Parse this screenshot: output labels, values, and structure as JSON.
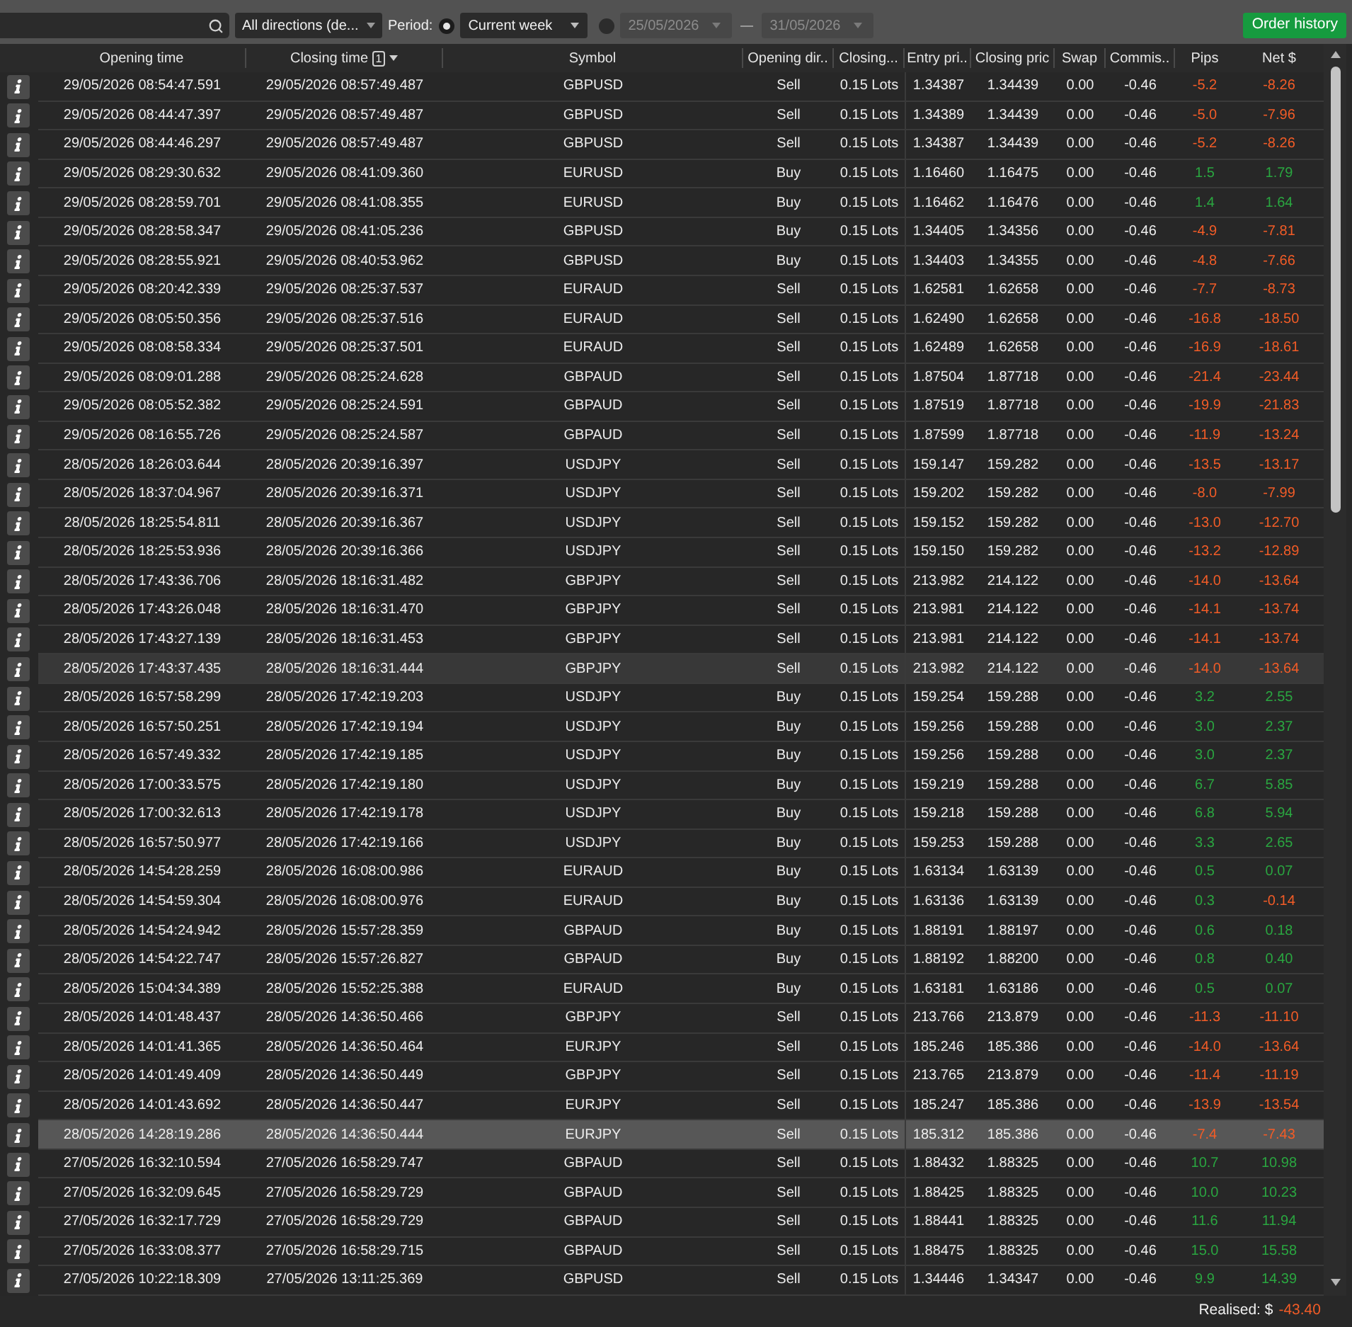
{
  "toolbar": {
    "direction_filter": {
      "value": "All directions (de..."
    },
    "period": {
      "label": "Period:",
      "options": [
        {
          "kind": "preset",
          "selected": true,
          "value": "Current week"
        },
        {
          "kind": "range",
          "selected": false,
          "from": "25/05/2026",
          "to": "31/05/2026"
        }
      ]
    },
    "order_history_button": "Order history"
  },
  "table": {
    "columns": [
      {
        "label": "Opening time"
      },
      {
        "label": "Closing time",
        "sort_rank": "1",
        "sorted_descending": true
      },
      {
        "label": "Symbol"
      },
      {
        "label": "Opening dir.."
      },
      {
        "label": "Closing..."
      },
      {
        "label": "Entry pri.."
      },
      {
        "label": "Closing pric"
      },
      {
        "label": "Swap"
      },
      {
        "label": "Commis.."
      },
      {
        "label": "Pips"
      },
      {
        "label": "Net $"
      }
    ],
    "rows": [
      {
        "opening_time": "29/05/2026 08:54:47.591",
        "closing_time": "29/05/2026 08:57:49.487",
        "symbol": "GBPUSD",
        "direction": "Sell",
        "volume": "0.15 Lots",
        "entry_price": "1.34387",
        "closing_price": "1.34439",
        "swap": "0.00",
        "commission": "-0.46",
        "pips": {
          "text": "-5.2",
          "color": "#f25c27"
        },
        "net": {
          "text": "-8.26",
          "color": "#f25c27"
        },
        "selected": false,
        "hovered": false
      },
      {
        "opening_time": "29/05/2026 08:44:47.397",
        "closing_time": "29/05/2026 08:57:49.487",
        "symbol": "GBPUSD",
        "direction": "Sell",
        "volume": "0.15 Lots",
        "entry_price": "1.34389",
        "closing_price": "1.34439",
        "swap": "0.00",
        "commission": "-0.46",
        "pips": {
          "text": "-5.0",
          "color": "#f25c27"
        },
        "net": {
          "text": "-7.96",
          "color": "#f25c27"
        },
        "selected": false,
        "hovered": false
      },
      {
        "opening_time": "29/05/2026 08:44:46.297",
        "closing_time": "29/05/2026 08:57:49.487",
        "symbol": "GBPUSD",
        "direction": "Sell",
        "volume": "0.15 Lots",
        "entry_price": "1.34387",
        "closing_price": "1.34439",
        "swap": "0.00",
        "commission": "-0.46",
        "pips": {
          "text": "-5.2",
          "color": "#f25c27"
        },
        "net": {
          "text": "-8.26",
          "color": "#f25c27"
        },
        "selected": false,
        "hovered": false
      },
      {
        "opening_time": "29/05/2026 08:29:30.632",
        "closing_time": "29/05/2026 08:41:09.360",
        "symbol": "EURUSD",
        "direction": "Buy",
        "volume": "0.15 Lots",
        "entry_price": "1.16460",
        "closing_price": "1.16475",
        "swap": "0.00",
        "commission": "-0.46",
        "pips": {
          "text": "1.5",
          "color": "#2aa640"
        },
        "net": {
          "text": "1.79",
          "color": "#2aa640"
        },
        "selected": false,
        "hovered": false
      },
      {
        "opening_time": "29/05/2026 08:28:59.701",
        "closing_time": "29/05/2026 08:41:08.355",
        "symbol": "EURUSD",
        "direction": "Buy",
        "volume": "0.15 Lots",
        "entry_price": "1.16462",
        "closing_price": "1.16476",
        "swap": "0.00",
        "commission": "-0.46",
        "pips": {
          "text": "1.4",
          "color": "#2aa640"
        },
        "net": {
          "text": "1.64",
          "color": "#2aa640"
        },
        "selected": false,
        "hovered": false
      },
      {
        "opening_time": "29/05/2026 08:28:58.347",
        "closing_time": "29/05/2026 08:41:05.236",
        "symbol": "GBPUSD",
        "direction": "Buy",
        "volume": "0.15 Lots",
        "entry_price": "1.34405",
        "closing_price": "1.34356",
        "swap": "0.00",
        "commission": "-0.46",
        "pips": {
          "text": "-4.9",
          "color": "#f25c27"
        },
        "net": {
          "text": "-7.81",
          "color": "#f25c27"
        },
        "selected": false,
        "hovered": false
      },
      {
        "opening_time": "29/05/2026 08:28:55.921",
        "closing_time": "29/05/2026 08:40:53.962",
        "symbol": "GBPUSD",
        "direction": "Buy",
        "volume": "0.15 Lots",
        "entry_price": "1.34403",
        "closing_price": "1.34355",
        "swap": "0.00",
        "commission": "-0.46",
        "pips": {
          "text": "-4.8",
          "color": "#f25c27"
        },
        "net": {
          "text": "-7.66",
          "color": "#f25c27"
        },
        "selected": false,
        "hovered": false
      },
      {
        "opening_time": "29/05/2026 08:20:42.339",
        "closing_time": "29/05/2026 08:25:37.537",
        "symbol": "EURAUD",
        "direction": "Sell",
        "volume": "0.15 Lots",
        "entry_price": "1.62581",
        "closing_price": "1.62658",
        "swap": "0.00",
        "commission": "-0.46",
        "pips": {
          "text": "-7.7",
          "color": "#f25c27"
        },
        "net": {
          "text": "-8.73",
          "color": "#f25c27"
        },
        "selected": false,
        "hovered": false
      },
      {
        "opening_time": "29/05/2026 08:05:50.356",
        "closing_time": "29/05/2026 08:25:37.516",
        "symbol": "EURAUD",
        "direction": "Sell",
        "volume": "0.15 Lots",
        "entry_price": "1.62490",
        "closing_price": "1.62658",
        "swap": "0.00",
        "commission": "-0.46",
        "pips": {
          "text": "-16.8",
          "color": "#f25c27"
        },
        "net": {
          "text": "-18.50",
          "color": "#f25c27"
        },
        "selected": false,
        "hovered": false
      },
      {
        "opening_time": "29/05/2026 08:08:58.334",
        "closing_time": "29/05/2026 08:25:37.501",
        "symbol": "EURAUD",
        "direction": "Sell",
        "volume": "0.15 Lots",
        "entry_price": "1.62489",
        "closing_price": "1.62658",
        "swap": "0.00",
        "commission": "-0.46",
        "pips": {
          "text": "-16.9",
          "color": "#f25c27"
        },
        "net": {
          "text": "-18.61",
          "color": "#f25c27"
        },
        "selected": false,
        "hovered": false
      },
      {
        "opening_time": "29/05/2026 08:09:01.288",
        "closing_time": "29/05/2026 08:25:24.628",
        "symbol": "GBPAUD",
        "direction": "Sell",
        "volume": "0.15 Lots",
        "entry_price": "1.87504",
        "closing_price": "1.87718",
        "swap": "0.00",
        "commission": "-0.46",
        "pips": {
          "text": "-21.4",
          "color": "#f25c27"
        },
        "net": {
          "text": "-23.44",
          "color": "#f25c27"
        },
        "selected": false,
        "hovered": false
      },
      {
        "opening_time": "29/05/2026 08:05:52.382",
        "closing_time": "29/05/2026 08:25:24.591",
        "symbol": "GBPAUD",
        "direction": "Sell",
        "volume": "0.15 Lots",
        "entry_price": "1.87519",
        "closing_price": "1.87718",
        "swap": "0.00",
        "commission": "-0.46",
        "pips": {
          "text": "-19.9",
          "color": "#f25c27"
        },
        "net": {
          "text": "-21.83",
          "color": "#f25c27"
        },
        "selected": false,
        "hovered": false
      },
      {
        "opening_time": "29/05/2026 08:16:55.726",
        "closing_time": "29/05/2026 08:25:24.587",
        "symbol": "GBPAUD",
        "direction": "Sell",
        "volume": "0.15 Lots",
        "entry_price": "1.87599",
        "closing_price": "1.87718",
        "swap": "0.00",
        "commission": "-0.46",
        "pips": {
          "text": "-11.9",
          "color": "#f25c27"
        },
        "net": {
          "text": "-13.24",
          "color": "#f25c27"
        },
        "selected": false,
        "hovered": false
      },
      {
        "opening_time": "28/05/2026 18:26:03.644",
        "closing_time": "28/05/2026 20:39:16.397",
        "symbol": "USDJPY",
        "direction": "Sell",
        "volume": "0.15 Lots",
        "entry_price": "159.147",
        "closing_price": "159.282",
        "swap": "0.00",
        "commission": "-0.46",
        "pips": {
          "text": "-13.5",
          "color": "#f25c27"
        },
        "net": {
          "text": "-13.17",
          "color": "#f25c27"
        },
        "selected": false,
        "hovered": false
      },
      {
        "opening_time": "28/05/2026 18:37:04.967",
        "closing_time": "28/05/2026 20:39:16.371",
        "symbol": "USDJPY",
        "direction": "Sell",
        "volume": "0.15 Lots",
        "entry_price": "159.202",
        "closing_price": "159.282",
        "swap": "0.00",
        "commission": "-0.46",
        "pips": {
          "text": "-8.0",
          "color": "#f25c27"
        },
        "net": {
          "text": "-7.99",
          "color": "#f25c27"
        },
        "selected": false,
        "hovered": false
      },
      {
        "opening_time": "28/05/2026 18:25:54.811",
        "closing_time": "28/05/2026 20:39:16.367",
        "symbol": "USDJPY",
        "direction": "Sell",
        "volume": "0.15 Lots",
        "entry_price": "159.152",
        "closing_price": "159.282",
        "swap": "0.00",
        "commission": "-0.46",
        "pips": {
          "text": "-13.0",
          "color": "#f25c27"
        },
        "net": {
          "text": "-12.70",
          "color": "#f25c27"
        },
        "selected": false,
        "hovered": false
      },
      {
        "opening_time": "28/05/2026 18:25:53.936",
        "closing_time": "28/05/2026 20:39:16.366",
        "symbol": "USDJPY",
        "direction": "Sell",
        "volume": "0.15 Lots",
        "entry_price": "159.150",
        "closing_price": "159.282",
        "swap": "0.00",
        "commission": "-0.46",
        "pips": {
          "text": "-13.2",
          "color": "#f25c27"
        },
        "net": {
          "text": "-12.89",
          "color": "#f25c27"
        },
        "selected": false,
        "hovered": false
      },
      {
        "opening_time": "28/05/2026 17:43:36.706",
        "closing_time": "28/05/2026 18:16:31.482",
        "symbol": "GBPJPY",
        "direction": "Sell",
        "volume": "0.15 Lots",
        "entry_price": "213.982",
        "closing_price": "214.122",
        "swap": "0.00",
        "commission": "-0.46",
        "pips": {
          "text": "-14.0",
          "color": "#f25c27"
        },
        "net": {
          "text": "-13.64",
          "color": "#f25c27"
        },
        "selected": false,
        "hovered": false
      },
      {
        "opening_time": "28/05/2026 17:43:26.048",
        "closing_time": "28/05/2026 18:16:31.470",
        "symbol": "GBPJPY",
        "direction": "Sell",
        "volume": "0.15 Lots",
        "entry_price": "213.981",
        "closing_price": "214.122",
        "swap": "0.00",
        "commission": "-0.46",
        "pips": {
          "text": "-14.1",
          "color": "#f25c27"
        },
        "net": {
          "text": "-13.74",
          "color": "#f25c27"
        },
        "selected": false,
        "hovered": false
      },
      {
        "opening_time": "28/05/2026 17:43:27.139",
        "closing_time": "28/05/2026 18:16:31.453",
        "symbol": "GBPJPY",
        "direction": "Sell",
        "volume": "0.15 Lots",
        "entry_price": "213.981",
        "closing_price": "214.122",
        "swap": "0.00",
        "commission": "-0.46",
        "pips": {
          "text": "-14.1",
          "color": "#f25c27"
        },
        "net": {
          "text": "-13.74",
          "color": "#f25c27"
        },
        "selected": false,
        "hovered": false
      },
      {
        "opening_time": "28/05/2026 17:43:37.435",
        "closing_time": "28/05/2026 18:16:31.444",
        "symbol": "GBPJPY",
        "direction": "Sell",
        "volume": "0.15 Lots",
        "entry_price": "213.982",
        "closing_price": "214.122",
        "swap": "0.00",
        "commission": "-0.46",
        "pips": {
          "text": "-14.0",
          "color": "#f25c27"
        },
        "net": {
          "text": "-13.64",
          "color": "#f25c27"
        },
        "selected": false,
        "hovered": true
      },
      {
        "opening_time": "28/05/2026 16:57:58.299",
        "closing_time": "28/05/2026 17:42:19.203",
        "symbol": "USDJPY",
        "direction": "Buy",
        "volume": "0.15 Lots",
        "entry_price": "159.254",
        "closing_price": "159.288",
        "swap": "0.00",
        "commission": "-0.46",
        "pips": {
          "text": "3.2",
          "color": "#2aa640"
        },
        "net": {
          "text": "2.55",
          "color": "#2aa640"
        },
        "selected": false,
        "hovered": false
      },
      {
        "opening_time": "28/05/2026 16:57:50.251",
        "closing_time": "28/05/2026 17:42:19.194",
        "symbol": "USDJPY",
        "direction": "Buy",
        "volume": "0.15 Lots",
        "entry_price": "159.256",
        "closing_price": "159.288",
        "swap": "0.00",
        "commission": "-0.46",
        "pips": {
          "text": "3.0",
          "color": "#2aa640"
        },
        "net": {
          "text": "2.37",
          "color": "#2aa640"
        },
        "selected": false,
        "hovered": false
      },
      {
        "opening_time": "28/05/2026 16:57:49.332",
        "closing_time": "28/05/2026 17:42:19.185",
        "symbol": "USDJPY",
        "direction": "Buy",
        "volume": "0.15 Lots",
        "entry_price": "159.256",
        "closing_price": "159.288",
        "swap": "0.00",
        "commission": "-0.46",
        "pips": {
          "text": "3.0",
          "color": "#2aa640"
        },
        "net": {
          "text": "2.37",
          "color": "#2aa640"
        },
        "selected": false,
        "hovered": false
      },
      {
        "opening_time": "28/05/2026 17:00:33.575",
        "closing_time": "28/05/2026 17:42:19.180",
        "symbol": "USDJPY",
        "direction": "Buy",
        "volume": "0.15 Lots",
        "entry_price": "159.219",
        "closing_price": "159.288",
        "swap": "0.00",
        "commission": "-0.46",
        "pips": {
          "text": "6.7",
          "color": "#2aa640"
        },
        "net": {
          "text": "5.85",
          "color": "#2aa640"
        },
        "selected": false,
        "hovered": false
      },
      {
        "opening_time": "28/05/2026 17:00:32.613",
        "closing_time": "28/05/2026 17:42:19.178",
        "symbol": "USDJPY",
        "direction": "Buy",
        "volume": "0.15 Lots",
        "entry_price": "159.218",
        "closing_price": "159.288",
        "swap": "0.00",
        "commission": "-0.46",
        "pips": {
          "text": "6.8",
          "color": "#2aa640"
        },
        "net": {
          "text": "5.94",
          "color": "#2aa640"
        },
        "selected": false,
        "hovered": false
      },
      {
        "opening_time": "28/05/2026 16:57:50.977",
        "closing_time": "28/05/2026 17:42:19.166",
        "symbol": "USDJPY",
        "direction": "Buy",
        "volume": "0.15 Lots",
        "entry_price": "159.253",
        "closing_price": "159.288",
        "swap": "0.00",
        "commission": "-0.46",
        "pips": {
          "text": "3.3",
          "color": "#2aa640"
        },
        "net": {
          "text": "2.65",
          "color": "#2aa640"
        },
        "selected": false,
        "hovered": false
      },
      {
        "opening_time": "28/05/2026 14:54:28.259",
        "closing_time": "28/05/2026 16:08:00.986",
        "symbol": "EURAUD",
        "direction": "Buy",
        "volume": "0.15 Lots",
        "entry_price": "1.63134",
        "closing_price": "1.63139",
        "swap": "0.00",
        "commission": "-0.46",
        "pips": {
          "text": "0.5",
          "color": "#2aa640"
        },
        "net": {
          "text": "0.07",
          "color": "#2aa640"
        },
        "selected": false,
        "hovered": false
      },
      {
        "opening_time": "28/05/2026 14:54:59.304",
        "closing_time": "28/05/2026 16:08:00.976",
        "symbol": "EURAUD",
        "direction": "Buy",
        "volume": "0.15 Lots",
        "entry_price": "1.63136",
        "closing_price": "1.63139",
        "swap": "0.00",
        "commission": "-0.46",
        "pips": {
          "text": "0.3",
          "color": "#2aa640"
        },
        "net": {
          "text": "-0.14",
          "color": "#f25c27"
        },
        "selected": false,
        "hovered": false
      },
      {
        "opening_time": "28/05/2026 14:54:24.942",
        "closing_time": "28/05/2026 15:57:28.359",
        "symbol": "GBPAUD",
        "direction": "Buy",
        "volume": "0.15 Lots",
        "entry_price": "1.88191",
        "closing_price": "1.88197",
        "swap": "0.00",
        "commission": "-0.46",
        "pips": {
          "text": "0.6",
          "color": "#2aa640"
        },
        "net": {
          "text": "0.18",
          "color": "#2aa640"
        },
        "selected": false,
        "hovered": false
      },
      {
        "opening_time": "28/05/2026 14:54:22.747",
        "closing_time": "28/05/2026 15:57:26.827",
        "symbol": "GBPAUD",
        "direction": "Buy",
        "volume": "0.15 Lots",
        "entry_price": "1.88192",
        "closing_price": "1.88200",
        "swap": "0.00",
        "commission": "-0.46",
        "pips": {
          "text": "0.8",
          "color": "#2aa640"
        },
        "net": {
          "text": "0.40",
          "color": "#2aa640"
        },
        "selected": false,
        "hovered": false
      },
      {
        "opening_time": "28/05/2026 15:04:34.389",
        "closing_time": "28/05/2026 15:52:25.388",
        "symbol": "EURAUD",
        "direction": "Buy",
        "volume": "0.15 Lots",
        "entry_price": "1.63181",
        "closing_price": "1.63186",
        "swap": "0.00",
        "commission": "-0.46",
        "pips": {
          "text": "0.5",
          "color": "#2aa640"
        },
        "net": {
          "text": "0.07",
          "color": "#2aa640"
        },
        "selected": false,
        "hovered": false
      },
      {
        "opening_time": "28/05/2026 14:01:48.437",
        "closing_time": "28/05/2026 14:36:50.466",
        "symbol": "GBPJPY",
        "direction": "Sell",
        "volume": "0.15 Lots",
        "entry_price": "213.766",
        "closing_price": "213.879",
        "swap": "0.00",
        "commission": "-0.46",
        "pips": {
          "text": "-11.3",
          "color": "#f25c27"
        },
        "net": {
          "text": "-11.10",
          "color": "#f25c27"
        },
        "selected": false,
        "hovered": false
      },
      {
        "opening_time": "28/05/2026 14:01:41.365",
        "closing_time": "28/05/2026 14:36:50.464",
        "symbol": "EURJPY",
        "direction": "Sell",
        "volume": "0.15 Lots",
        "entry_price": "185.246",
        "closing_price": "185.386",
        "swap": "0.00",
        "commission": "-0.46",
        "pips": {
          "text": "-14.0",
          "color": "#f25c27"
        },
        "net": {
          "text": "-13.64",
          "color": "#f25c27"
        },
        "selected": false,
        "hovered": false
      },
      {
        "opening_time": "28/05/2026 14:01:49.409",
        "closing_time": "28/05/2026 14:36:50.449",
        "symbol": "GBPJPY",
        "direction": "Sell",
        "volume": "0.15 Lots",
        "entry_price": "213.765",
        "closing_price": "213.879",
        "swap": "0.00",
        "commission": "-0.46",
        "pips": {
          "text": "-11.4",
          "color": "#f25c27"
        },
        "net": {
          "text": "-11.19",
          "color": "#f25c27"
        },
        "selected": false,
        "hovered": false
      },
      {
        "opening_time": "28/05/2026 14:01:43.692",
        "closing_time": "28/05/2026 14:36:50.447",
        "symbol": "EURJPY",
        "direction": "Sell",
        "volume": "0.15 Lots",
        "entry_price": "185.247",
        "closing_price": "185.386",
        "swap": "0.00",
        "commission": "-0.46",
        "pips": {
          "text": "-13.9",
          "color": "#f25c27"
        },
        "net": {
          "text": "-13.54",
          "color": "#f25c27"
        },
        "selected": false,
        "hovered": false
      },
      {
        "opening_time": "28/05/2026 14:28:19.286",
        "closing_time": "28/05/2026 14:36:50.444",
        "symbol": "EURJPY",
        "direction": "Sell",
        "volume": "0.15 Lots",
        "entry_price": "185.312",
        "closing_price": "185.386",
        "swap": "0.00",
        "commission": "-0.46",
        "pips": {
          "text": "-7.4",
          "color": "#f25c27"
        },
        "net": {
          "text": "-7.43",
          "color": "#f25c27"
        },
        "selected": true,
        "hovered": false
      },
      {
        "opening_time": "27/05/2026 16:32:10.594",
        "closing_time": "27/05/2026 16:58:29.747",
        "symbol": "GBPAUD",
        "direction": "Sell",
        "volume": "0.15 Lots",
        "entry_price": "1.88432",
        "closing_price": "1.88325",
        "swap": "0.00",
        "commission": "-0.46",
        "pips": {
          "text": "10.7",
          "color": "#2aa640"
        },
        "net": {
          "text": "10.98",
          "color": "#2aa640"
        },
        "selected": false,
        "hovered": false
      },
      {
        "opening_time": "27/05/2026 16:32:09.645",
        "closing_time": "27/05/2026 16:58:29.729",
        "symbol": "GBPAUD",
        "direction": "Sell",
        "volume": "0.15 Lots",
        "entry_price": "1.88425",
        "closing_price": "1.88325",
        "swap": "0.00",
        "commission": "-0.46",
        "pips": {
          "text": "10.0",
          "color": "#2aa640"
        },
        "net": {
          "text": "10.23",
          "color": "#2aa640"
        },
        "selected": false,
        "hovered": false
      },
      {
        "opening_time": "27/05/2026 16:32:17.729",
        "closing_time": "27/05/2026 16:58:29.729",
        "symbol": "GBPAUD",
        "direction": "Sell",
        "volume": "0.15 Lots",
        "entry_price": "1.88441",
        "closing_price": "1.88325",
        "swap": "0.00",
        "commission": "-0.46",
        "pips": {
          "text": "11.6",
          "color": "#2aa640"
        },
        "net": {
          "text": "11.94",
          "color": "#2aa640"
        },
        "selected": false,
        "hovered": false
      },
      {
        "opening_time": "27/05/2026 16:33:08.377",
        "closing_time": "27/05/2026 16:58:29.715",
        "symbol": "GBPAUD",
        "direction": "Sell",
        "volume": "0.15 Lots",
        "entry_price": "1.88475",
        "closing_price": "1.88325",
        "swap": "0.00",
        "commission": "-0.46",
        "pips": {
          "text": "15.0",
          "color": "#2aa640"
        },
        "net": {
          "text": "15.58",
          "color": "#2aa640"
        },
        "selected": false,
        "hovered": false
      },
      {
        "opening_time": "27/05/2026 10:22:18.309",
        "closing_time": "27/05/2026 13:11:25.369",
        "symbol": "GBPUSD",
        "direction": "Sell",
        "volume": "0.15 Lots",
        "entry_price": "1.34446",
        "closing_price": "1.34347",
        "swap": "0.00",
        "commission": "-0.46",
        "pips": {
          "text": "9.9",
          "color": "#2aa640"
        },
        "net": {
          "text": "14.39",
          "color": "#2aa640"
        },
        "selected": false,
        "hovered": false
      }
    ]
  },
  "footer": {
    "label": "Realised: $",
    "value": "-43.40",
    "color": "#f25c27"
  }
}
